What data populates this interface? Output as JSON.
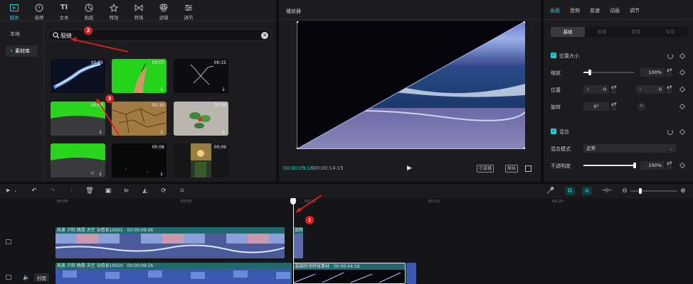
{
  "tool_tabs": [
    {
      "label": "媒体",
      "icon": "media-icon",
      "active": true
    },
    {
      "label": "音频",
      "icon": "audio-icon"
    },
    {
      "label": "文本",
      "icon": "text-icon"
    },
    {
      "label": "贴纸",
      "icon": "sticker-icon"
    },
    {
      "label": "特效",
      "icon": "effects-icon"
    },
    {
      "label": "转场",
      "icon": "transition-icon"
    },
    {
      "label": "滤镜",
      "icon": "filter-icon"
    },
    {
      "label": "调节",
      "icon": "adjust-icon"
    }
  ],
  "sidebar": {
    "items": [
      {
        "label": "本地"
      },
      {
        "label": "素材库",
        "selected": true
      }
    ]
  },
  "search": {
    "value": "裂缝"
  },
  "thumbnails": [
    {
      "duration": "00:05",
      "style": "crack-blue"
    },
    {
      "duration": "00:03",
      "style": "green-hand"
    },
    {
      "duration": "00:15",
      "style": "lightning"
    },
    {
      "duration": "00:08",
      "style": "green-ground"
    },
    {
      "duration": "00:10",
      "style": "dry-earth"
    },
    {
      "duration": "00:08",
      "style": "plant"
    },
    {
      "duration": "",
      "style": "green-ground2"
    },
    {
      "duration": "00:08",
      "style": "dark"
    },
    {
      "duration": "00:09",
      "style": "portrait"
    }
  ],
  "annotations": [
    "1",
    "2",
    "3"
  ],
  "player": {
    "title": "播放器",
    "current_time": "00:00:09:16",
    "total_time": "00:00:14:15",
    "btn_scope": "示波器",
    "btn_original": "原始"
  },
  "props": {
    "tabs": [
      {
        "label": "画面",
        "active": true
      },
      {
        "label": "音频"
      },
      {
        "label": "变速"
      },
      {
        "label": "动画"
      },
      {
        "label": "调节"
      }
    ],
    "subtabs": [
      {
        "label": "基础",
        "active": true
      },
      {
        "label": "抠像"
      },
      {
        "label": "蒙版"
      },
      {
        "label": "背景"
      }
    ],
    "position_size": {
      "title": "位置大小",
      "scale_label": "缩放",
      "scale_value": "100%",
      "scale_level": 0.12,
      "position_label": "位置",
      "x_label": "X",
      "x_value": "0",
      "y_label": "Y",
      "y_value": "0",
      "rotate_label": "旋转",
      "rotate_value": "0°"
    },
    "blend": {
      "title": "混合",
      "mode_label": "混合模式",
      "mode_value": "正常",
      "opacity_label": "不透明度",
      "opacity_value": "100%",
      "opacity_level": 1.0
    }
  },
  "timeline": {
    "ruler_labels": [
      "00:00",
      "00:05",
      "00:10",
      "00:15",
      "00:20"
    ],
    "cover_label": "封面",
    "clips": [
      {
        "title": "风景 夕阳 晚霞 天空 治愈系10001",
        "time": "00:00:09:06"
      },
      {
        "title": "流转",
        "time": ""
      },
      {
        "title": "风景 夕阳 晚霞 天空 治愈系10020",
        "time": "00:00:09:16"
      },
      {
        "title": "裂缝转场特效素材",
        "time": "00:00:04:16"
      }
    ]
  },
  "colors": {
    "accent": "#1fc9d6",
    "annotation": "#e02020",
    "clip_header": "#1f6a6e"
  }
}
